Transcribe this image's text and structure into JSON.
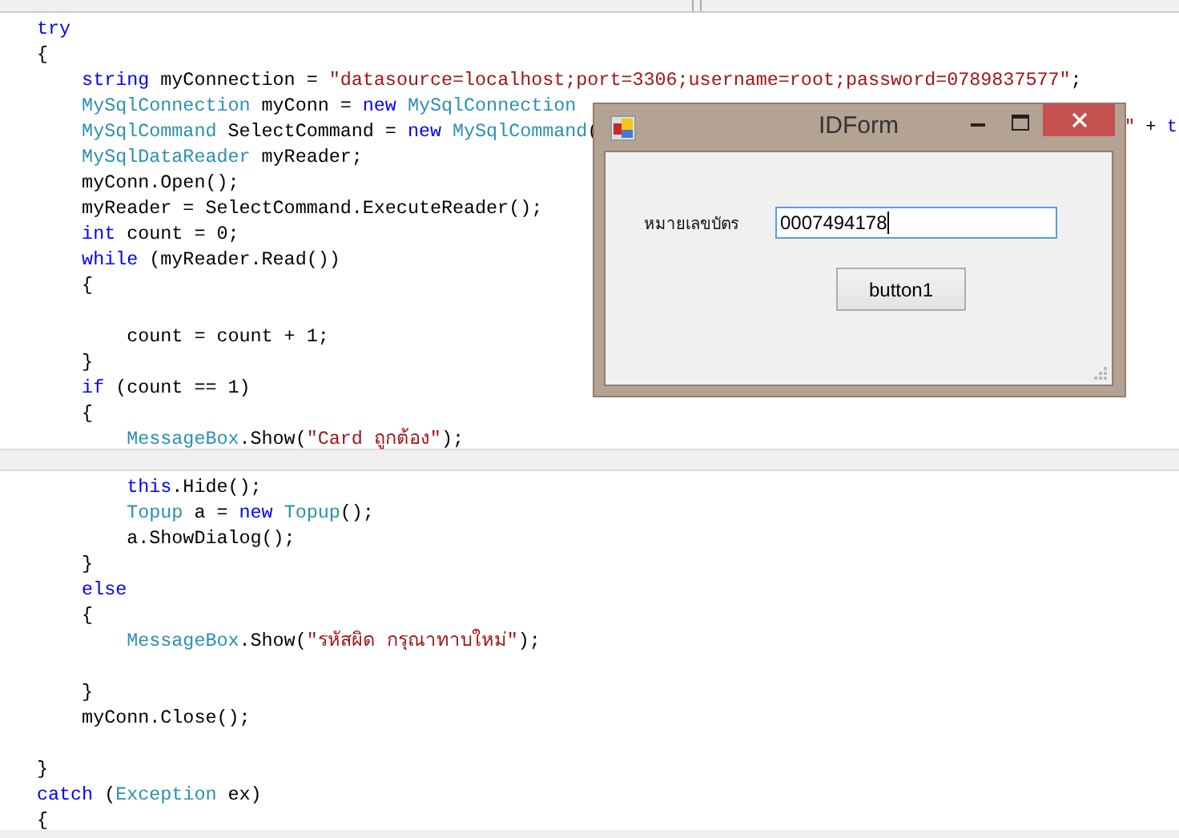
{
  "code_panes": [
    {
      "lines": [
        {
          "kind": "code",
          "tokens": [
            {
              "kind": "keyword",
              "text": "try"
            }
          ]
        },
        {
          "kind": "code",
          "tokens": [
            {
              "kind": "plain",
              "text": "{"
            }
          ]
        },
        {
          "kind": "code",
          "tokens": [
            {
              "kind": "keyword",
              "text": "    string"
            },
            {
              "kind": "plain",
              "text": " myConnection = "
            },
            {
              "kind": "string",
              "text": "\"datasource=localhost;port=3306;username=root;password=0789837577\""
            },
            {
              "kind": "plain",
              "text": ";"
            }
          ]
        },
        {
          "kind": "code",
          "tokens": [
            {
              "kind": "type",
              "text": "    MySqlConnection"
            },
            {
              "kind": "plain",
              "text": " myConn = "
            },
            {
              "kind": "keyword",
              "text": "new"
            },
            {
              "kind": "type",
              "text": " MySqlConnection"
            }
          ]
        },
        {
          "kind": "code",
          "tokens": [
            {
              "kind": "type",
              "text": "    MySqlCommand"
            },
            {
              "kind": "plain",
              "text": " SelectCommand = "
            },
            {
              "kind": "keyword",
              "text": "new"
            },
            {
              "kind": "type",
              "text": " MySqlCommand"
            },
            {
              "kind": "plain",
              "text": "("
            }
          ],
          "tail": [
            {
              "kind": "string",
              "text": "\""
            },
            {
              "kind": "plain",
              "text": " + "
            },
            {
              "kind": "keyword",
              "text": "t"
            }
          ]
        },
        {
          "kind": "code",
          "tokens": [
            {
              "kind": "type",
              "text": "    MySqlDataReader"
            },
            {
              "kind": "plain",
              "text": " myReader;"
            }
          ]
        },
        {
          "kind": "code",
          "tokens": [
            {
              "kind": "plain",
              "text": "    myConn.Open();"
            }
          ]
        },
        {
          "kind": "code",
          "tokens": [
            {
              "kind": "plain",
              "text": "    myReader = SelectCommand.ExecuteReader();"
            }
          ]
        },
        {
          "kind": "code",
          "tokens": [
            {
              "kind": "keyword",
              "text": "    int"
            },
            {
              "kind": "plain",
              "text": " count = 0;"
            }
          ]
        },
        {
          "kind": "code",
          "tokens": [
            {
              "kind": "keyword",
              "text": "    while"
            },
            {
              "kind": "plain",
              "text": " (myReader.Read())"
            }
          ]
        },
        {
          "kind": "code",
          "tokens": [
            {
              "kind": "plain",
              "text": "    {"
            }
          ]
        },
        {
          "kind": "blank"
        },
        {
          "kind": "code",
          "tokens": [
            {
              "kind": "plain",
              "text": "        count = count + 1;"
            }
          ]
        },
        {
          "kind": "code",
          "tokens": [
            {
              "kind": "plain",
              "text": "    }"
            }
          ]
        },
        {
          "kind": "code",
          "tokens": [
            {
              "kind": "keyword",
              "text": "    if"
            },
            {
              "kind": "plain",
              "text": " (count == 1)"
            }
          ]
        },
        {
          "kind": "code",
          "tokens": [
            {
              "kind": "plain",
              "text": "    {"
            }
          ]
        },
        {
          "kind": "code",
          "tokens": [
            {
              "kind": "type",
              "text": "        MessageBox"
            },
            {
              "kind": "plain",
              "text": ".Show("
            },
            {
              "kind": "string",
              "text": "\"Card ถูกต้อง\""
            },
            {
              "kind": "plain",
              "text": ");"
            }
          ]
        }
      ]
    },
    {
      "lines": [
        {
          "kind": "code",
          "tokens": [
            {
              "kind": "keyword",
              "text": "        this"
            },
            {
              "kind": "plain",
              "text": ".Hide();"
            }
          ]
        },
        {
          "kind": "code",
          "tokens": [
            {
              "kind": "type",
              "text": "        Topup"
            },
            {
              "kind": "plain",
              "text": " a = "
            },
            {
              "kind": "keyword",
              "text": "new"
            },
            {
              "kind": "type",
              "text": " Topup"
            },
            {
              "kind": "plain",
              "text": "();"
            }
          ]
        },
        {
          "kind": "code",
          "tokens": [
            {
              "kind": "plain",
              "text": "        a.ShowDialog();"
            }
          ]
        },
        {
          "kind": "code",
          "tokens": [
            {
              "kind": "plain",
              "text": "    }"
            }
          ]
        },
        {
          "kind": "code",
          "tokens": [
            {
              "kind": "keyword",
              "text": "    else"
            }
          ]
        },
        {
          "kind": "code",
          "tokens": [
            {
              "kind": "plain",
              "text": "    {"
            }
          ]
        },
        {
          "kind": "code",
          "tokens": [
            {
              "kind": "type",
              "text": "        MessageBox"
            },
            {
              "kind": "plain",
              "text": ".Show("
            },
            {
              "kind": "string",
              "text": "\"รหัสผิด กรุณาทาบใหม่\""
            },
            {
              "kind": "plain",
              "text": ");"
            }
          ]
        },
        {
          "kind": "blank"
        },
        {
          "kind": "code",
          "tokens": [
            {
              "kind": "plain",
              "text": "    }"
            }
          ]
        },
        {
          "kind": "code",
          "tokens": [
            {
              "kind": "plain",
              "text": "    myConn.Close();"
            }
          ]
        },
        {
          "kind": "blank"
        },
        {
          "kind": "code",
          "tokens": [
            {
              "kind": "plain",
              "text": "}"
            }
          ]
        },
        {
          "kind": "code",
          "tokens": [
            {
              "kind": "keyword",
              "text": "catch"
            },
            {
              "kind": "plain",
              "text": " ("
            },
            {
              "kind": "type",
              "text": "Exception"
            },
            {
              "kind": "plain",
              "text": " ex)"
            }
          ]
        },
        {
          "kind": "code",
          "tokens": [
            {
              "kind": "plain",
              "text": "{"
            }
          ]
        }
      ]
    }
  ],
  "dialog": {
    "title": "IDForm",
    "field_label": "หมายเลขบัตร",
    "field_value": "0007494178",
    "focused": true,
    "button": "button1"
  }
}
